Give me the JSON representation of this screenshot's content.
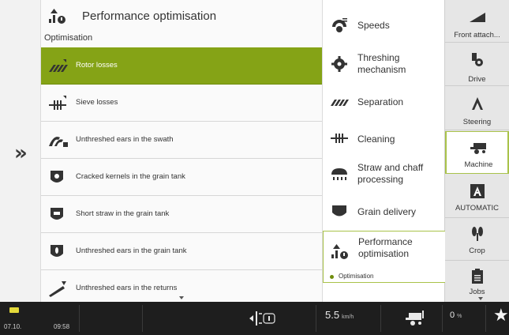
{
  "left": {
    "collapse_glyph": "»"
  },
  "header": {
    "title": "Performance optimisation",
    "icon": "performance-optimisation-icon"
  },
  "section_label": "Optimisation",
  "list": [
    {
      "label": "Rotor losses",
      "icon": "rotor-losses-icon",
      "active": true
    },
    {
      "label": "Sieve losses",
      "icon": "sieve-losses-icon",
      "active": false
    },
    {
      "label": "Unthreshed ears in the swath",
      "icon": "swath-ears-icon",
      "active": false
    },
    {
      "label": "Cracked kernels in the grain tank",
      "icon": "grain-tank-icon",
      "active": false
    },
    {
      "label": "Short straw in the grain tank",
      "icon": "grain-tank-straw-icon",
      "active": false
    },
    {
      "label": "Unthreshed ears in the grain tank",
      "icon": "grain-tank-ears-icon",
      "active": false
    },
    {
      "label": "Unthreshed ears in the returns",
      "icon": "returns-icon",
      "active": false
    }
  ],
  "menu": [
    {
      "label": "Speeds",
      "icon": "speeds-icon"
    },
    {
      "label": "Threshing mechanism",
      "icon": "threshing-gear-icon"
    },
    {
      "label": "Separation",
      "icon": "separation-icon"
    },
    {
      "label": "Cleaning",
      "icon": "cleaning-icon"
    },
    {
      "label": "Straw and chaff processing",
      "icon": "straw-chaff-icon"
    },
    {
      "label": "Grain delivery",
      "icon": "grain-delivery-icon"
    },
    {
      "label": "Performance optimisation",
      "icon": "performance-optimisation-icon",
      "selected": true
    }
  ],
  "menu_sub": {
    "label": "Optimisation"
  },
  "tabs": [
    {
      "label": "Front attach...",
      "icon": "front-attachment-icon"
    },
    {
      "label": "Drive",
      "icon": "drive-icon"
    },
    {
      "label": "Steering",
      "icon": "steering-icon"
    },
    {
      "label": "Machine",
      "icon": "combine-harvester-icon",
      "active": true
    },
    {
      "label": "AUTOMATIC",
      "icon": "automatic-a-icon"
    },
    {
      "label": "Crop",
      "icon": "crop-icon"
    },
    {
      "label": "Jobs",
      "icon": "jobs-clipboard-icon"
    }
  ],
  "status": {
    "date": "07.10.",
    "time": "09:58",
    "speed": "5.5",
    "speed_unit": "km/h",
    "percent": "0",
    "percent_unit": "%",
    "star": "★"
  },
  "colors": {
    "active_green": "#85a316",
    "selection_border": "#a9c24a",
    "status_bar": "#1e1e1e",
    "battery": "#e3d93a"
  }
}
